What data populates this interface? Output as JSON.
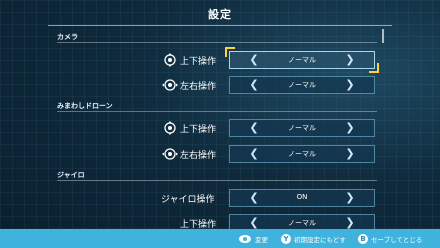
{
  "title": "設定",
  "sections": [
    {
      "name": "カメラ",
      "rows": [
        {
          "icon": "stick-vertical-icon",
          "label": "上下操作",
          "value": "ノーマル",
          "active": true
        },
        {
          "icon": "stick-horizontal-icon",
          "label": "左右操作",
          "value": "ノーマル",
          "active": false
        }
      ]
    },
    {
      "name": "みまわしドローン",
      "rows": [
        {
          "icon": "stick-vertical-icon",
          "label": "上下操作",
          "value": "ノーマル",
          "active": false
        },
        {
          "icon": "stick-horizontal-icon",
          "label": "左右操作",
          "value": "ノーマル",
          "active": false
        }
      ]
    },
    {
      "name": "ジャイロ",
      "rows": [
        {
          "icon": "",
          "label": "ジャイロ操作",
          "value": "ON",
          "active": false
        },
        {
          "icon": "",
          "label": "上下操作",
          "value": "ノーマル",
          "active": false
        }
      ]
    }
  ],
  "arrows": {
    "left": "❮",
    "right": "❯"
  },
  "footer": {
    "change": {
      "icon": "stick-icon",
      "label": "変更"
    },
    "reset": {
      "button": "Y",
      "label": "初期設定にもどす"
    },
    "save": {
      "button": "B",
      "label": "セーブしてとじる"
    }
  },
  "colors": {
    "focus": "#ffd23a",
    "footer": "#3fb3dd",
    "background": "#0f2a3c"
  }
}
